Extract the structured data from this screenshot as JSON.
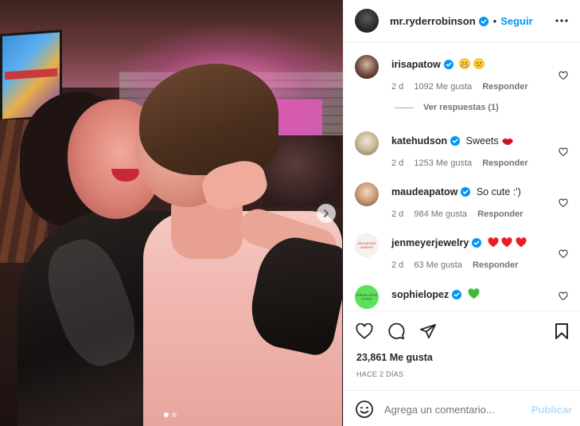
{
  "post": {
    "owner": "mr.ryderrobinson",
    "separator": "•",
    "follow_label": "Seguir",
    "likes": "23,861 Me gusta",
    "date": "HACE 2 DÍAS",
    "carousel": {
      "count": 2,
      "active_index": 0
    }
  },
  "comments": [
    {
      "user": "irisapatow",
      "verified": true,
      "text": "",
      "emoji": [
        "grimace-face",
        "grimace-face-2"
      ],
      "age": "2 d",
      "likes": "1092 Me gusta",
      "reply_label": "Responder",
      "replies_label": "Ver respuestas (1)"
    },
    {
      "user": "katehudson",
      "verified": true,
      "text": "Sweets",
      "emoji": [
        "lips"
      ],
      "age": "2 d",
      "likes": "1253 Me gusta",
      "reply_label": "Responder"
    },
    {
      "user": "maudeapatow",
      "verified": true,
      "text": "So cute :')",
      "emoji": [],
      "age": "2 d",
      "likes": "984 Me gusta",
      "reply_label": "Responder"
    },
    {
      "user": "jenmeyerjewelry",
      "verified": true,
      "text": "",
      "emoji": [
        "red-heart",
        "red-heart",
        "red-heart"
      ],
      "age": "2 d",
      "likes": "63 Me gusta",
      "reply_label": "Responder"
    },
    {
      "user": "sophielopez",
      "verified": true,
      "text": "",
      "emoji": [
        "green-heart"
      ]
    }
  ],
  "composer": {
    "placeholder": "Agrega un comentario...",
    "publish_label": "Publicar"
  },
  "colors": {
    "link_blue": "#0095f6",
    "verified_blue": "#0095f6",
    "publish_disabled": "#b2dffc",
    "heart_red": "#ed1c24",
    "heart_green": "#3dba3a"
  }
}
